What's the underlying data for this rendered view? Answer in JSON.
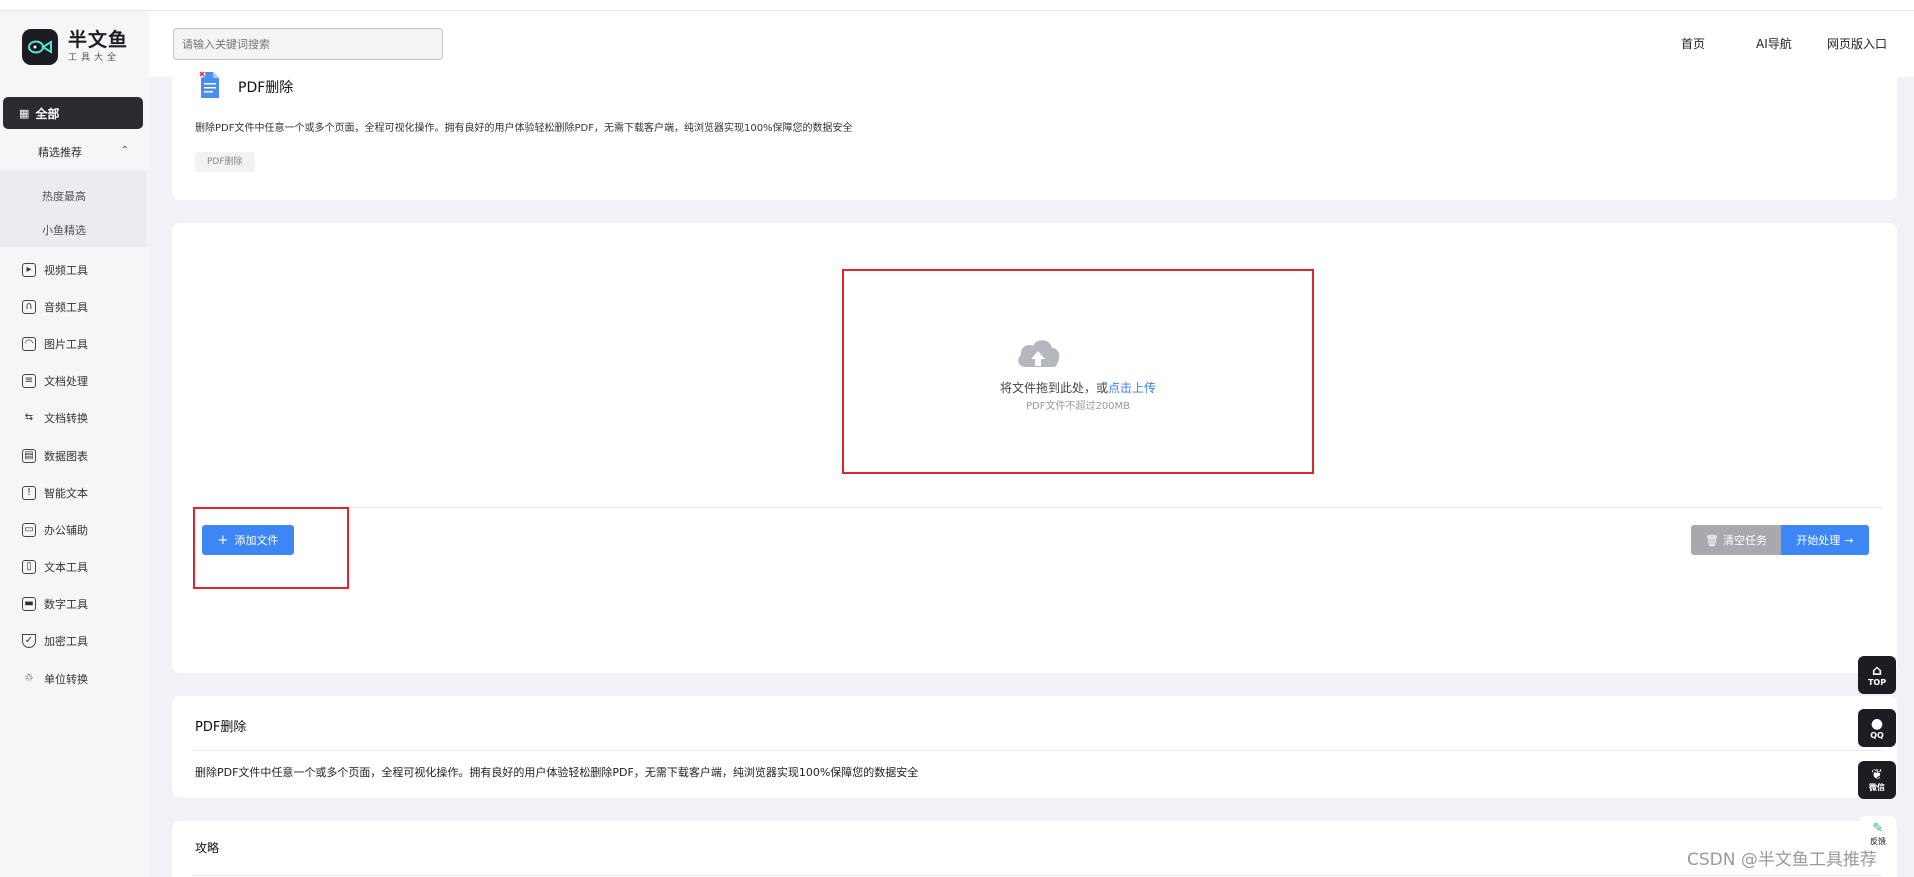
{
  "brand": {
    "name": "半文鱼",
    "subtitle": "工具大全"
  },
  "search": {
    "placeholder": "请输入关键词搜索"
  },
  "topnav": {
    "home": "首页",
    "ai_nav": "AI导航",
    "web_entry": "网页版入口"
  },
  "sidebar": {
    "all": "全部",
    "featured": "精选推荐",
    "featured_items": [
      "热度最高",
      "小鱼精选"
    ],
    "items": [
      {
        "label": "视频工具",
        "icon": "video-icon"
      },
      {
        "label": "音频工具",
        "icon": "headphones-icon"
      },
      {
        "label": "图片工具",
        "icon": "image-icon"
      },
      {
        "label": "文档处理",
        "icon": "document-icon"
      },
      {
        "label": "文档转换",
        "icon": "convert-icon"
      },
      {
        "label": "数据图表",
        "icon": "table-icon"
      },
      {
        "label": "智能文本",
        "icon": "ai-text-icon"
      },
      {
        "label": "办公辅助",
        "icon": "briefcase-icon"
      },
      {
        "label": "文本工具",
        "icon": "clipboard-icon"
      },
      {
        "label": "数字工具",
        "icon": "monitor-icon"
      },
      {
        "label": "加密工具",
        "icon": "shield-icon"
      },
      {
        "label": "单位转换",
        "icon": "recycle-icon"
      }
    ]
  },
  "tool": {
    "title": "PDF删除",
    "description": "删除PDF文件中任意一个或多个页面，全程可视化操作。拥有良好的用户体验轻松删除PDF，无需下载客户端，纯浏览器实现100%保障您的数据安全",
    "tag": "PDF删除"
  },
  "upload": {
    "drop_text": "将文件拖到此处，或",
    "drop_link": "点击上传",
    "hint": "PDF文件不超过200MB",
    "add_button": "添加文件",
    "clear_button": "清空任务",
    "start_button": "开始处理"
  },
  "description_card": {
    "title": "PDF删除",
    "text": "删除PDF文件中任意一个或多个页面，全程可视化操作。拥有良好的用户体验轻松删除PDF，无需下载客户端，纯浏览器实现100%保障您的数据安全"
  },
  "strategy_card": {
    "title": "攻略"
  },
  "floats": {
    "top": "TOP",
    "qq": "QQ",
    "wechat": "微信",
    "feedback": "反馈"
  },
  "watermark": "CSDN @半文鱼工具推荐",
  "colors": {
    "accent": "#3d86f5",
    "highlight_box": "#e0252b",
    "dark": "#1c1d22"
  }
}
